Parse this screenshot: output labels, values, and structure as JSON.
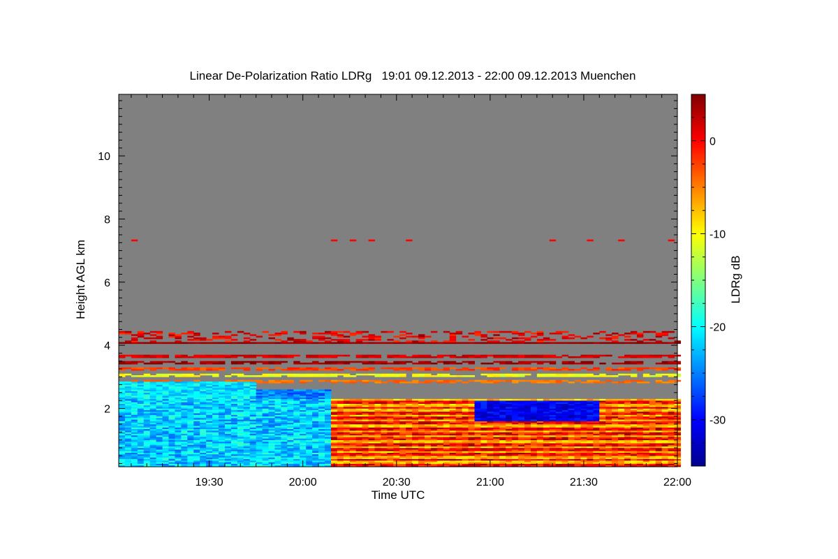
{
  "chart_data": {
    "type": "heatmap",
    "title": "Linear De-Polarization Ratio LDRg   19:01 09.12.2013 - 22:00 09.12.2013 Muenchen",
    "xlabel": "Time UTC",
    "ylabel": "Height AGL km",
    "colorbar_label": "LDRg dB",
    "x_range": [
      "19:01",
      "22:00"
    ],
    "y_range": [
      0.15,
      11.95
    ],
    "color_range": [
      -35,
      5
    ],
    "x_ticks": [
      "19:30",
      "20:00",
      "20:30",
      "21:00",
      "21:30",
      "22:00"
    ],
    "y_ticks": [
      2,
      4,
      6,
      8,
      10
    ],
    "colorbar_ticks": [
      0,
      -10,
      -20,
      -30
    ],
    "no_data_color": "#808080",
    "colormap": "jet",
    "regions": [
      {
        "feature": "layer top band",
        "height_km": [
          4.05,
          4.45
        ],
        "ldr_db": 0
      },
      {
        "feature": "low-depolarization cloud",
        "time": [
          "19:01",
          "20:10"
        ],
        "height_km": [
          0.2,
          2.8
        ],
        "ldr_db": -23
      },
      {
        "feature": "low-depolarization cloud",
        "time": [
          "20:55",
          "21:35"
        ],
        "height_km": [
          1.7,
          2.3
        ],
        "ldr_db": -31
      },
      {
        "feature": "boundary layer",
        "time": [
          "19:01",
          "22:00"
        ],
        "height_km": [
          0.2,
          2.3
        ],
        "ldr_db": -3
      }
    ]
  }
}
